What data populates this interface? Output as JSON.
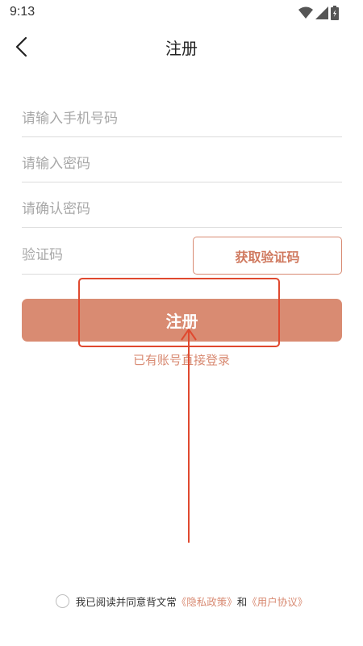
{
  "status_bar": {
    "time": "9:13",
    "icons": [
      "wifi-icon",
      "signal-icon",
      "battery-icon"
    ]
  },
  "header": {
    "title": "注册",
    "back_icon": "chevron-left-icon"
  },
  "form": {
    "phone_placeholder": "请输入手机号码",
    "password_placeholder": "请输入密码",
    "confirm_password_placeholder": "请确认密码",
    "code_placeholder": "验证码",
    "get_code_label": "获取验证码",
    "submit_label": "注册",
    "login_link": "已有账号直接登录"
  },
  "agreement": {
    "text": "我已阅读并同意背文常",
    "privacy_link": "《隐私政策》",
    "and": "和",
    "terms_link": "《用户协议》",
    "checked": false
  },
  "colors": {
    "accent": "#d98b72",
    "accent_text": "#d07a60",
    "annotation_red": "#e0492f"
  }
}
